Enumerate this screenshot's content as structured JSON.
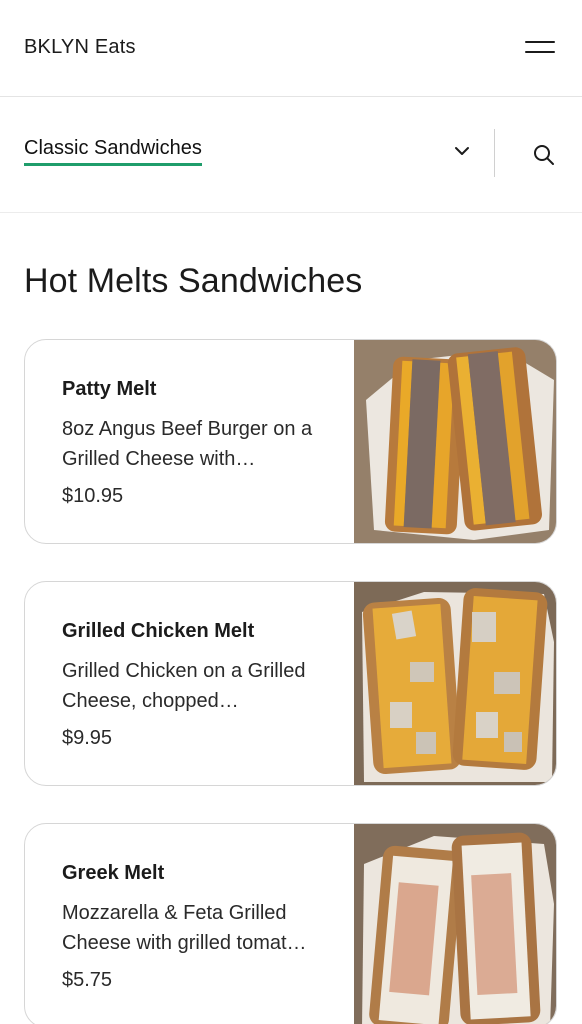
{
  "header": {
    "brand": "BKLYN Eats",
    "menu_icon": "hamburger-menu-icon"
  },
  "category_bar": {
    "selected_category": "Classic Sandwiches",
    "dropdown_icon": "chevron-down-icon",
    "search_icon": "search-icon",
    "accent_color": "#1f9d6b"
  },
  "section": {
    "title": "Hot Melts Sandwiches"
  },
  "items": [
    {
      "name": "Patty Melt",
      "description": "8oz Angus Beef Burger on a Grilled Cheese with…",
      "price": "$10.95"
    },
    {
      "name": "Grilled Chicken Melt",
      "description": "Grilled Chicken on a Grilled Cheese, chopped…",
      "price": "$9.95"
    },
    {
      "name": "Greek Melt",
      "description": "Mozzarella & Feta Grilled Cheese with grilled tomat…",
      "price": "$5.75"
    }
  ]
}
